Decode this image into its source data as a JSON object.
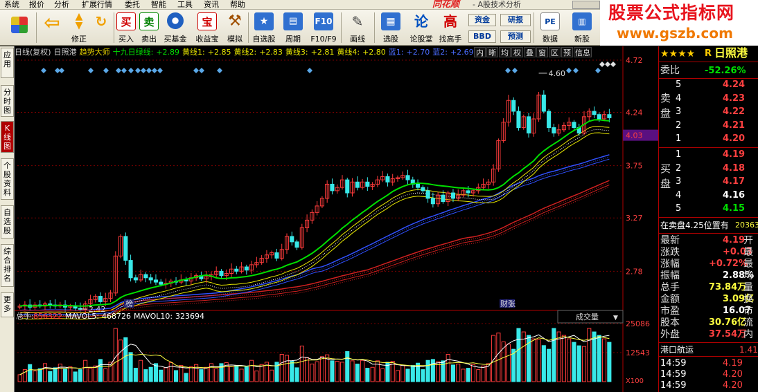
{
  "menu": {
    "items": [
      "系统",
      "报价",
      "分析",
      "扩展行情",
      "委托",
      "智能",
      "工具",
      "资讯",
      "帮助"
    ],
    "logo": "同花顺",
    "subtitle": "- A股技术分析"
  },
  "toolbar": {
    "buttons": [
      {
        "name": "layout-button",
        "label": "",
        "icon": "layout-icon"
      },
      {
        "name": "back-button",
        "label": "",
        "icon": "arrow-left-icon"
      },
      {
        "name": "fix-button",
        "label": "修正",
        "icon": "updown-icon"
      },
      {
        "name": "buy-button",
        "label": "买入",
        "glyph": "买",
        "icon": "buy-icon"
      },
      {
        "name": "sell-button",
        "label": "卖出",
        "glyph": "卖",
        "icon": "sell-icon"
      },
      {
        "name": "buy-fund-button",
        "label": "买基金",
        "icon": "fund-icon"
      },
      {
        "name": "earn-button",
        "label": "收益宝",
        "glyph": "宝",
        "icon": "earn-icon"
      },
      {
        "name": "simulate-button",
        "label": "模拟",
        "icon": "hammer-icon"
      },
      {
        "name": "watchlist-button",
        "label": "自选股",
        "icon": "star-icon"
      },
      {
        "name": "cycle-button",
        "label": "周期",
        "icon": "cycle-icon"
      },
      {
        "name": "f10-button",
        "label": "F10/F9",
        "icon": "f10-icon"
      },
      {
        "name": "draw-button",
        "label": "画线",
        "icon": "pencil-icon"
      },
      {
        "name": "select-stock-button",
        "label": "选股",
        "icon": "select-icon"
      },
      {
        "name": "forum-button",
        "label": "论股堂",
        "glyph": "论",
        "icon": "forum-icon"
      },
      {
        "name": "high-button",
        "label": "找高手",
        "glyph": "高",
        "icon": "high-icon"
      },
      {
        "name": "data-button",
        "label": "数据",
        "icon": "pe-icon",
        "glyph": "PE"
      },
      {
        "name": "new-stock-button",
        "label": "新股",
        "icon": "ipo-icon"
      }
    ],
    "small": {
      "fund": "资金",
      "bbd": "BBD",
      "research": "研报",
      "forecast": "预测"
    }
  },
  "banner": {
    "line1": "股票公式指标网",
    "line2": "www.gszb.com"
  },
  "lefttabs": [
    "应用",
    "分时图",
    "K线图",
    "个股资料",
    "自选股",
    "综合排名",
    "更多"
  ],
  "chart": {
    "header": [
      {
        "t": "日线(复权)",
        "c": "#d0d0d0"
      },
      {
        "t": "日照港",
        "c": "#d0d0d0"
      },
      {
        "t": "趋势大师",
        "c": "#e6d200"
      },
      {
        "t": "十九日绿线:",
        "c": "#00e000"
      },
      {
        "t": "+2.89",
        "c": "#00e000"
      },
      {
        "t": "黄线1:",
        "c": "#e6e600"
      },
      {
        "t": "+2.85",
        "c": "#e6e600"
      },
      {
        "t": "黄线2:",
        "c": "#e6e600"
      },
      {
        "t": "+2.83",
        "c": "#e6e600"
      },
      {
        "t": "黄线3:",
        "c": "#e6e600"
      },
      {
        "t": "+2.81",
        "c": "#e6e600"
      },
      {
        "t": "黄线4:",
        "c": "#e6e600"
      },
      {
        "t": "+2.80",
        "c": "#e6e600"
      },
      {
        "t": "蓝1:",
        "c": "#4a6cff"
      },
      {
        "t": "+2.70",
        "c": "#4a6cff"
      },
      {
        "t": "蓝2:",
        "c": "#4a6cff"
      },
      {
        "t": "+2.69",
        "c": "#4a6cff"
      }
    ],
    "tools": [
      "内",
      "晰",
      "均",
      "权",
      "叠",
      "窗",
      "区",
      "预",
      "信息"
    ],
    "price_ticks": [
      "4.72",
      "4.24",
      "3.75",
      "3.27",
      "2.78"
    ],
    "current_price": "4.03",
    "annotation_high": "4.60",
    "annotation_low": "2.42",
    "marker_bang": "榜",
    "marker_caizhang": "财张",
    "volume_header": {
      "total_label": "总手:",
      "total": "856322",
      "mavol5_label": "MAVOL5:",
      "mavol5": "468726",
      "mavol10_label": "MAVOL10:",
      "mavol10": "323694"
    },
    "volume_selector": "成交量",
    "volume_ticks": [
      "25086",
      "12543"
    ],
    "volume_unit": "X100",
    "colors": {
      "up": "#ff3c3c",
      "down": "#38e8e8",
      "green": "#00e000",
      "yellow": "#e6e600",
      "blue": "#3050ff",
      "red": "#d02020",
      "grid": "#7a0000"
    }
  },
  "chart_data": {
    "type": "candlestick",
    "title": "日照港",
    "ylim": [
      2.42,
      4.72
    ],
    "series_note": "approximate daily closes",
    "closes": [
      2.46,
      2.47,
      2.45,
      2.47,
      2.46,
      2.48,
      2.47,
      2.46,
      2.47,
      2.45,
      2.46,
      2.44,
      2.43,
      2.48,
      2.52,
      2.55,
      2.5,
      2.53,
      2.58,
      2.92,
      3.1,
      2.88,
      2.72,
      2.7,
      2.75,
      2.72,
      2.7,
      2.68,
      2.66,
      2.67,
      2.69,
      2.68,
      2.7,
      2.69,
      2.72,
      2.74,
      2.71,
      2.73,
      2.75,
      2.78,
      2.74,
      2.76,
      2.8,
      2.78,
      2.82,
      2.79,
      2.84,
      2.86,
      2.9,
      2.93,
      2.95,
      2.9,
      2.98,
      3.1,
      3.05,
      3.0,
      3.18,
      3.25,
      3.32,
      3.38,
      3.45,
      3.58,
      3.52,
      3.55,
      3.62,
      3.5,
      3.6,
      3.55,
      3.6,
      3.56,
      3.58,
      3.62,
      3.65,
      3.6,
      3.63,
      3.64,
      3.66,
      3.62,
      3.58,
      3.55,
      3.52,
      3.45,
      3.4,
      3.48,
      3.42,
      3.5,
      3.45,
      3.48,
      3.52,
      3.5,
      3.52,
      3.55,
      3.58,
      3.6,
      3.72,
      3.98,
      4.15,
      4.35,
      4.25,
      4.1,
      4.2,
      4.05,
      4.18,
      4.4,
      4.25,
      4.1,
      4.05,
      4.08,
      4.12,
      4.15,
      4.1,
      4.05,
      4.2,
      4.25,
      4.22,
      4.18,
      4.22,
      4.19
    ],
    "ma_green_last": 2.89
  },
  "quote": {
    "stars": "★★★★",
    "r": "R",
    "name": "日照港",
    "weibi_label": "委比",
    "weibi": "-52.26%",
    "sell_label": "卖盘",
    "buy_label": "买盘",
    "sell": [
      {
        "n": "5",
        "p": "4.24"
      },
      {
        "n": "4",
        "p": "4.23"
      },
      {
        "n": "3",
        "p": "4.22"
      },
      {
        "n": "2",
        "p": "4.21"
      },
      {
        "n": "1",
        "p": "4.20"
      }
    ],
    "buy": [
      {
        "n": "1",
        "p": "4.19"
      },
      {
        "n": "2",
        "p": "4.18"
      },
      {
        "n": "3",
        "p": "4.17"
      },
      {
        "n": "4",
        "p": "4.16"
      },
      {
        "n": "5",
        "p": "4.15"
      }
    ],
    "sell_pos": "在卖盘4.25位置有",
    "sell_pos_vol": "20363",
    "stats": [
      {
        "l": "最新",
        "v": "4.19",
        "c": "#ff4040",
        "s": "开"
      },
      {
        "l": "涨跌",
        "v": "+0.03",
        "c": "#ff4040",
        "s": "最"
      },
      {
        "l": "涨幅",
        "v": "+0.72%",
        "c": "#ff4040",
        "s": "最"
      },
      {
        "l": "振幅",
        "v": "2.88%",
        "c": "#ffffff",
        "s": "均"
      },
      {
        "l": "总手",
        "v": "73.84万",
        "c": "#ffff40",
        "s": "量"
      },
      {
        "l": "金额",
        "v": "3.09亿",
        "c": "#ffff40",
        "s": "换"
      },
      {
        "l": "市盈",
        "v": "16.07",
        "c": "#ffffff",
        "s": "市"
      },
      {
        "l": "股本",
        "v": "30.76亿",
        "c": "#ffff40",
        "s": "流"
      },
      {
        "l": "外盘",
        "v": "37.54万",
        "c": "#ff4040",
        "s": "内"
      }
    ],
    "sector": "港口航运",
    "sector_val": "1.41",
    "ticks": [
      {
        "t": "14:59",
        "p": "4.19"
      },
      {
        "t": "14:59",
        "p": "4.20"
      },
      {
        "t": "14:59",
        "p": "4.20"
      }
    ]
  }
}
